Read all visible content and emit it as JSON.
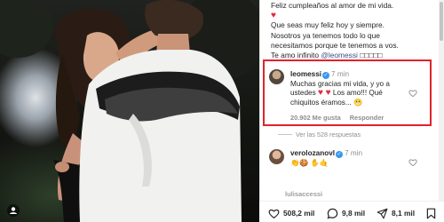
{
  "photo": {
    "badge_icon": "user-tag-icon"
  },
  "caption": {
    "line1": "Feliz cumpleaños al amor de mi vida.",
    "heart": "♥",
    "line2": "Que seas muy feliz hoy y siempre.",
    "line3": "Nosotros ya tenemos todo lo que",
    "line4": "necesitamos porque te tenemos a vos.",
    "line5_prefix": "Te amo infinito ",
    "mention": "@leomessi",
    "line5_suffix": " □□□□□"
  },
  "highlighted_comment": {
    "username": "leomessi",
    "time": "7 min",
    "text_line1": "Muchas gracias mi vida, y yo a",
    "text_line2_prefix": "ustedes ",
    "text_hearts": "♥ ♥",
    "text_line2_suffix": " Los amo!!! Qué",
    "text_line3": "chiquitos éramos... ",
    "emoji": "😬",
    "likes": "20.902 Me gusta",
    "reply": "Responder"
  },
  "view_replies": "Ver las 528 respuestas",
  "second_comment": {
    "username": "verolozanovl",
    "time": "7 min",
    "text": "👏🍪 ✋🤙"
  },
  "third_comment": {
    "username": "lulisaccessi"
  },
  "actions": {
    "likes": "508,2 mil",
    "comments": "9,8 mil",
    "shares": "8,1 mil"
  },
  "colors": {
    "highlight": "#e2222d",
    "verified": "#3897f0",
    "heart": "#e02a3a"
  }
}
